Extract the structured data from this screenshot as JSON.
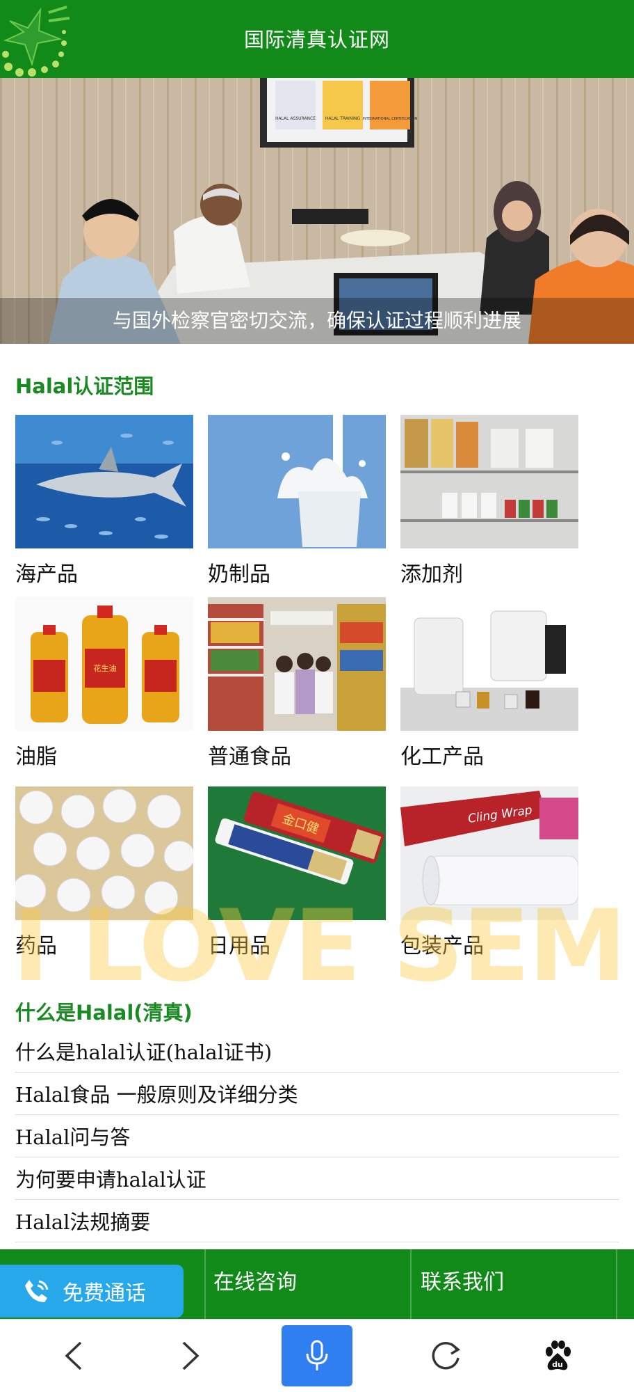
{
  "header": {
    "title": "国际清真认证网"
  },
  "hero": {
    "caption": "与国外检察官密切交流，确保认证过程顺利进展",
    "poster_labels": [
      "HALAL ASSURANCE",
      "HALAL TRAINING",
      "INTERNATIONAL CERTIFICATION"
    ]
  },
  "scope": {
    "title": "Halal认证范围",
    "items": [
      {
        "label": "海产品"
      },
      {
        "label": "奶制品"
      },
      {
        "label": "添加剂"
      },
      {
        "label": "油脂"
      },
      {
        "label": "普通食品"
      },
      {
        "label": "化工产品"
      },
      {
        "label": "药品"
      },
      {
        "label": "日用品"
      },
      {
        "label": "包装产品"
      }
    ],
    "product_texts": {
      "oil": "花生油",
      "toothpaste": "金口健",
      "wrap": "Cling Wrap"
    }
  },
  "watermark": "I LOVE SEMI",
  "faq": {
    "title": "什么是Halal(清真)",
    "links": [
      "什么是halal认证(halal证书)",
      "Halal食品 一般原则及详细分类",
      "Halal问与答",
      "为何要申请halal认证",
      "Halal法规摘要"
    ]
  },
  "bottom_nav": {
    "call_label": "免费通话",
    "consult_label": "在线咨询",
    "contact_label": "联系我们"
  },
  "browser": {
    "icons": [
      "back-icon",
      "forward-icon",
      "microphone-icon",
      "refresh-icon",
      "baidu-paw-icon"
    ]
  },
  "colors": {
    "brand_green": "#118a1a",
    "title_green": "#1a8a22",
    "call_blue": "#26a8ea",
    "mic_blue": "#2f7ff0"
  }
}
